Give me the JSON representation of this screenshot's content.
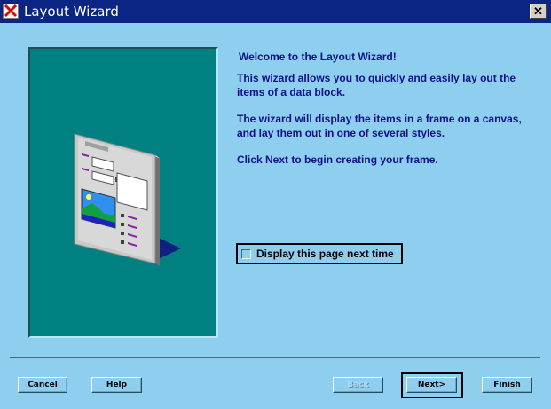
{
  "window": {
    "title": "Layout Wizard",
    "close_glyph": "✕"
  },
  "content": {
    "welcome": "Welcome to the Layout Wizard!",
    "para1": "This wizard allows you to quickly and easily lay out the items of a data block.",
    "para2": "The wizard will display the items in a frame on a canvas, and lay them out in one of several styles.",
    "para3": "Click Next to begin creating your frame."
  },
  "checkbox": {
    "label": "Display this page next time",
    "checked": false
  },
  "buttons": {
    "cancel": "Cancel",
    "help": "Help",
    "back": "Back",
    "next": "Next>",
    "finish": "Finish"
  },
  "colors": {
    "titlebar": "#0b2585",
    "background": "#8ecfef",
    "panel": "#008080",
    "text": "#10108a"
  }
}
